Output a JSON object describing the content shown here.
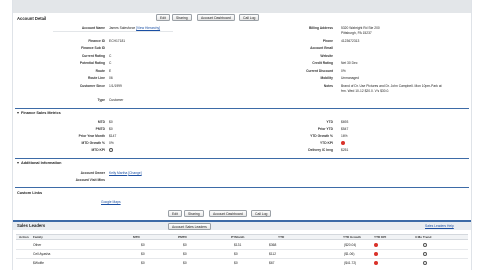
{
  "account_detail": {
    "title": "Account Detail",
    "buttons": [
      "Edit",
      "Sharing",
      "Account Dashboard",
      "Call Log"
    ],
    "left_fields": [
      {
        "label": "Account Name",
        "value": "James Salesforce",
        "link": "[View Hierarchy]"
      },
      {
        "label": "Finance ID",
        "value": "ECH17181"
      },
      {
        "label": "Finance Sub ID",
        "value": ""
      },
      {
        "label": "Current Rating",
        "value": "C"
      },
      {
        "label": "Potential Rating",
        "value": "C"
      },
      {
        "label": "Route",
        "value": "E"
      },
      {
        "label": "Route Line",
        "value": "06"
      },
      {
        "label": "Customer Since",
        "value": "1/1/1999"
      },
      {
        "label": "Type",
        "value": "Customer"
      }
    ],
    "right_fields": [
      {
        "label": "Billing Address",
        "value_lines": [
          "5320 Wabright Rd Ste 200",
          "Pittsburgh, PA 15237"
        ]
      },
      {
        "label": "Phone",
        "value_lines": [
          "4123672313"
        ]
      },
      {
        "label": "Account Email",
        "value_lines": [
          ""
        ]
      },
      {
        "label": "Website",
        "value_lines": [
          ""
        ]
      },
      {
        "label": "Credit Rating",
        "value_lines": [
          "Net 30 Dec"
        ]
      },
      {
        "label": "Current Discount",
        "value_lines": [
          "0%"
        ]
      },
      {
        "label": "Mobility",
        "value_lines": [
          "Unmanaged"
        ]
      },
      {
        "label": "Notes",
        "value_lines": [
          "Brand of Dr. Use Pictures and Dr. John Campbell. Mon 10pm-Park at",
          "frm. Wed 10-12 $20.0. V’s $30.0."
        ]
      }
    ]
  },
  "finance_metrics": {
    "title": "Finance Sales Metrics",
    "left": [
      {
        "label": "MTD",
        "value": "$0"
      },
      {
        "label": "PMTD",
        "value": "$0"
      },
      {
        "label": "Prior Year Month",
        "value": "$147"
      },
      {
        "label": "MTD Growth %",
        "value": "0%"
      },
      {
        "label": "MTD KPI",
        "value": ""
      }
    ],
    "right": [
      {
        "label": "YTD",
        "value": "$693"
      },
      {
        "label": "Prior YTD",
        "value": "$547"
      },
      {
        "label": "YTD Growth %",
        "value": "16%"
      },
      {
        "label": "YTD KPI",
        "value": ""
      },
      {
        "label": "Delivery IC Invg",
        "value": "$251"
      }
    ]
  },
  "additional_info": {
    "title": "Additional Information",
    "fields": [
      {
        "label": "Account Owner",
        "value": "Kelly Martha",
        "link": "[Change]"
      },
      {
        "label": "Account Visit Mins",
        "value": ""
      }
    ]
  },
  "custom_links": {
    "title": "Custom Links",
    "link": "Google Maps"
  },
  "bottom_buttons": [
    "Edit",
    "Sharing",
    "Account Dashboard",
    "Call Log"
  ],
  "sales_leaders": {
    "title": "Sales Leaders",
    "button": "Account Sales Leaders",
    "help": "Sales Leaders Help",
    "columns": [
      "Action",
      "Family",
      "MTD",
      "PMTD",
      "PYMonth",
      "YTD",
      "YTD Growth",
      "YTD KPI",
      "3 Mo Trend"
    ],
    "rows": [
      {
        "family": "Other",
        "mtd": "$0",
        "pmtd": "$0",
        "pymonth": "$131",
        "ytd": "$368",
        "growth": "($20.04)"
      },
      {
        "family": "Cell Ayasha",
        "mtd": "$0",
        "pmtd": "$0",
        "pymonth": "$0",
        "ytd": "$112",
        "growth": "($1.06)"
      },
      {
        "family": "$Wolfie",
        "mtd": "$0",
        "pmtd": "$0",
        "pymonth": "$0",
        "ytd": "$67",
        "growth": "($41.72)"
      }
    ]
  },
  "colors": {
    "section_line": "#3d6ba7",
    "link": "#1a4fa3",
    "kpi_red": "#d9322a"
  }
}
